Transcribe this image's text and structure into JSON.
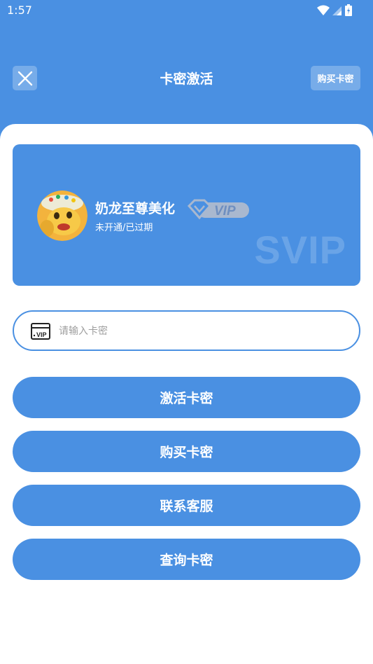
{
  "status_bar": {
    "time": "1:57",
    "icons": [
      "wifi-icon",
      "signal-icon",
      "battery-icon"
    ]
  },
  "header": {
    "title": "卡密激活",
    "buy_button": "购买卡密",
    "close_icon": "close-icon"
  },
  "vip_card": {
    "product_name": "奶龙至尊美化",
    "badge_text": "VIP",
    "status": "未开通/已过期",
    "watermark": "SVIP"
  },
  "card_input": {
    "placeholder": "请输入卡密",
    "value": "",
    "icon_text": "VIP"
  },
  "buttons": {
    "activate": "激活卡密",
    "buy": "购买卡密",
    "contact": "联系客服",
    "query": "查询卡密"
  },
  "colors": {
    "primary": "#4A90E2",
    "background": "#FFFFFF"
  }
}
